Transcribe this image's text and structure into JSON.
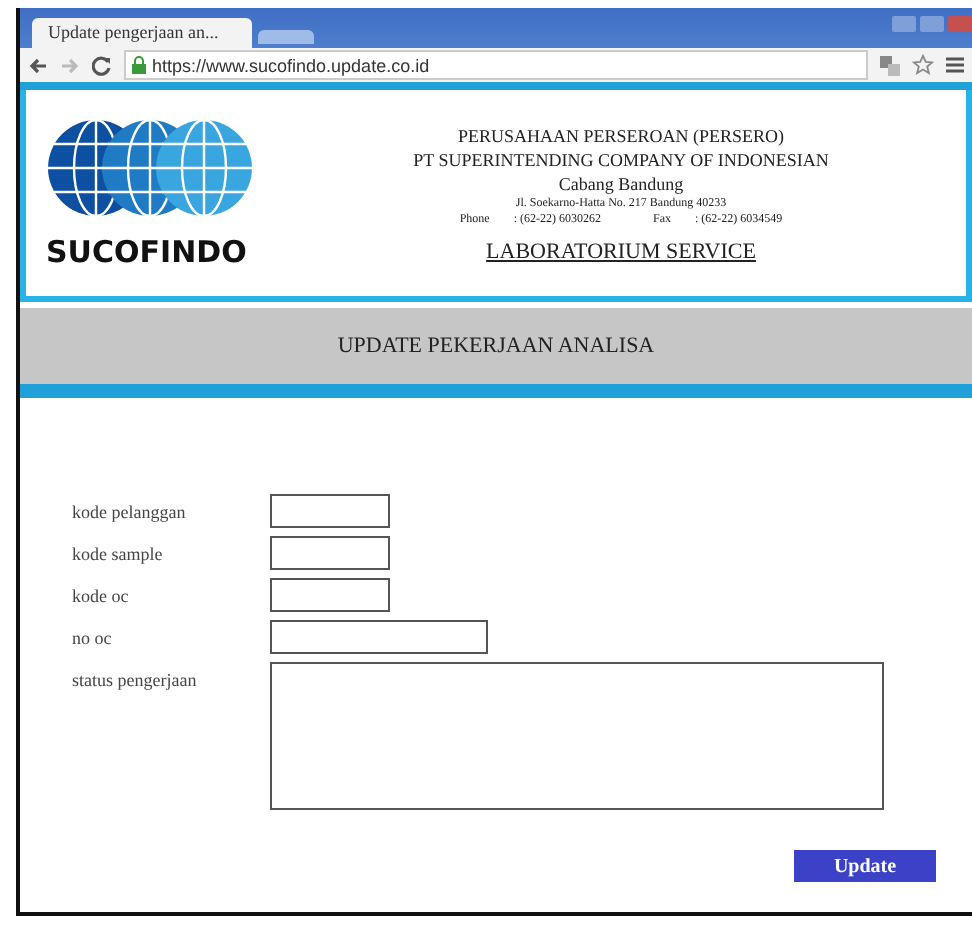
{
  "browser": {
    "tabs": [
      {
        "title": "Update pengerjaan an...",
        "selected": true
      },
      {
        "selected": false
      }
    ],
    "address": {
      "url": "https://www.sucofindo.update.co.id",
      "secure": true
    }
  },
  "header": {
    "logo_text": "SUCOFINDO",
    "lines": [
      "PERUSAHAAN PERSEROAN (PERSERO)",
      "PT SUPERINTENDING COMPANY OF INDONESIAN",
      "Cabang Bandung"
    ],
    "address": "Jl. Soekarno-Hatta No. 217 Bandung 40233",
    "phone_label": "Phone",
    "phone": ": (62-22) 6030262",
    "fax_label": "Fax",
    "fax": ": (62-22) 6034549",
    "service": "LABORATORIUM SERVICE"
  },
  "page_title": "UPDATE PEKERJAAN ANALISA",
  "form": {
    "fields": [
      {
        "label": "kode pelanggan",
        "kind": "short"
      },
      {
        "label": "kode sample",
        "kind": "short"
      },
      {
        "label": "kode oc",
        "kind": "short"
      },
      {
        "label": "no oc",
        "kind": "wide"
      },
      {
        "label": "status pengerjaan",
        "kind": "textarea"
      }
    ],
    "submit": "Update"
  }
}
